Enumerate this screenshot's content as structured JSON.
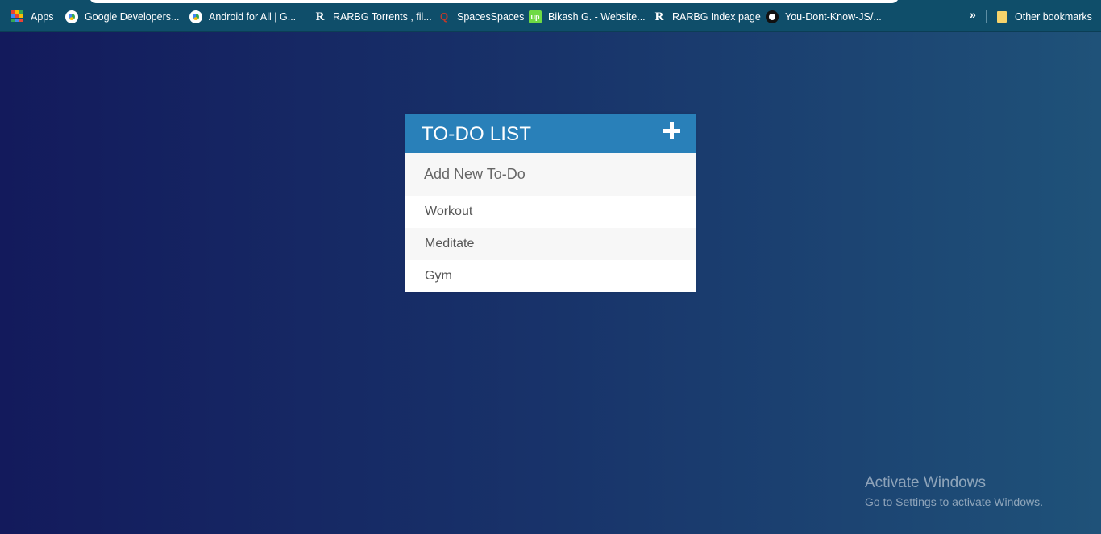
{
  "bookmarks": {
    "items": [
      {
        "label": "Apps",
        "icon": "apps-grid-icon"
      },
      {
        "label": "Google Developers...",
        "icon": "google-developers-icon"
      },
      {
        "label": "Android for All  |  G...",
        "icon": "google-developers-icon"
      },
      {
        "label": "RARBG Torrents , fil...",
        "icon": "rarbg-icon"
      },
      {
        "label": "SpacesSpaces",
        "icon": "quora-icon"
      },
      {
        "label": "Bikash G. - Website...",
        "icon": "upwork-icon"
      },
      {
        "label": "RARBG Index page",
        "icon": "rarbg-icon"
      },
      {
        "label": "You-Dont-Know-JS/...",
        "icon": "github-icon"
      }
    ],
    "overflow_glyph": "»",
    "other_bookmarks": "Other bookmarks"
  },
  "todo": {
    "title": "TO-DO LIST",
    "add_glyph": "+",
    "input_placeholder": "Add New To-Do",
    "items": [
      "Workout",
      "Meditate",
      "Gym"
    ],
    "header_color": "#2980b9"
  },
  "watermark": {
    "title": "Activate Windows",
    "subtitle": "Go to Settings to activate Windows."
  }
}
